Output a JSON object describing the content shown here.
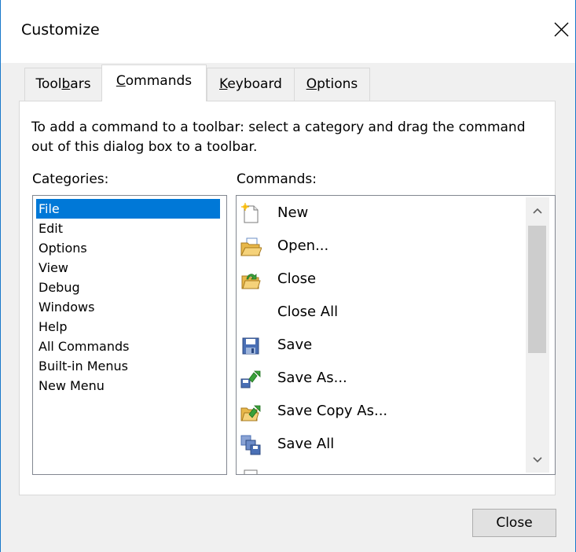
{
  "window": {
    "title": "Customize"
  },
  "tabs": [
    {
      "label": "Toolbars",
      "accel": "b"
    },
    {
      "label": "Commands",
      "accel": "C"
    },
    {
      "label": "Keyboard",
      "accel": "K"
    },
    {
      "label": "Options",
      "accel": "O"
    }
  ],
  "active_tab": "Commands",
  "instructions": "To add a command to a toolbar: select a category and drag the command out of this dialog box to a toolbar.",
  "categories": {
    "label": "Categories:",
    "items": [
      "File",
      "Edit",
      "Options",
      "View",
      "Debug",
      "Windows",
      "Help",
      "All Commands",
      "Built-in Menus",
      "New Menu"
    ],
    "selected": "File"
  },
  "commands": {
    "label": "Commands:",
    "items": [
      {
        "label": "New",
        "icon": "new-document-icon"
      },
      {
        "label": "Open...",
        "icon": "open-folder-icon"
      },
      {
        "label": "Close",
        "icon": "close-folder-icon"
      },
      {
        "label": "Close All",
        "icon": ""
      },
      {
        "label": "Save",
        "icon": "save-disk-icon"
      },
      {
        "label": "Save As...",
        "icon": "save-as-icon"
      },
      {
        "label": "Save Copy As...",
        "icon": "save-copy-icon"
      },
      {
        "label": "Save All",
        "icon": "save-all-icon"
      }
    ]
  },
  "buttons": {
    "close": "Close"
  },
  "colors": {
    "selection": "#0078d7",
    "window_border": "#1979ca"
  }
}
